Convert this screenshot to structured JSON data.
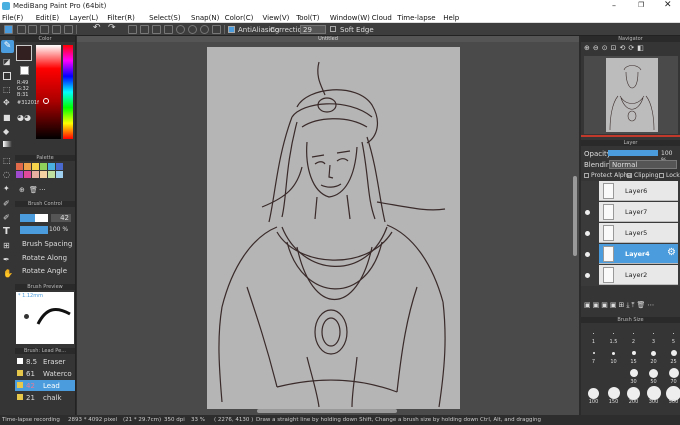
{
  "window": {
    "title": "MediBang Paint Pro (64bit)"
  },
  "menu": [
    "File(F)",
    "Edit(E)",
    "Layer(L)",
    "Filter(R)",
    "Select(S)",
    "Snap(N)",
    "Color(C)",
    "View(V)",
    "Tool(T)",
    "Window(W)",
    "Cloud",
    "Time-lapse",
    "Help"
  ],
  "toolbar": {
    "antialias_label": "AntiAliasing",
    "correction_label": "Correction",
    "correction_value": "29",
    "soft_edge_label": "Soft Edge"
  },
  "canvas": {
    "tab_title": "Untitled"
  },
  "color_panel": {
    "title": "Color",
    "r": "R:49",
    "g": "G:32",
    "b": "B:31",
    "hex": "#31201f",
    "main_color": "#31201f"
  },
  "palette": {
    "title": "Palette",
    "swatches": [
      "#e06a4a",
      "#f0a24a",
      "#f5d34a",
      "#8fd05a",
      "#4ab0e0",
      "#4a6ad0",
      "#a04ad0",
      "#e04a9a",
      "#e8b0a0",
      "#f5d0a0",
      "#c0e0a0",
      "#a0d0f0"
    ]
  },
  "brush_control": {
    "title": "Brush Control",
    "size_value": "42",
    "opacity_value": "100 %",
    "spacing_label": "Brush Spacing",
    "rotate_along_label": "Rotate Along",
    "rotate_angle_label": "Rotate Angle",
    "size_fill": 0.55,
    "opacity_fill": 1.0
  },
  "brush_preview": {
    "title": "Brush Preview",
    "size": "* 1.12mm"
  },
  "brush_list": {
    "title": "Brush: Lead Pe...",
    "items": [
      {
        "size": "8.5",
        "name": "Eraser",
        "color": "#ffffff"
      },
      {
        "size": "61",
        "name": "Waterco",
        "color": "#e8c84a"
      },
      {
        "size": "42",
        "name": "Lead",
        "color": "#e8c84a"
      },
      {
        "size": "21",
        "name": "chalk",
        "color": "#e8c84a"
      }
    ]
  },
  "navigator": {
    "title": "Navigator"
  },
  "layer_panel": {
    "title": "Layer",
    "opacity_label": "Opacity",
    "opacity_value": "100 %",
    "opacity_fill": 1.0,
    "blending_label": "Blending",
    "blending_value": "Normal",
    "protect_alpha": "Protect Alpha",
    "clipping": "Clipping",
    "lock": "Lock",
    "layers": [
      {
        "name": "Layer6",
        "visible": false,
        "selected": false
      },
      {
        "name": "Layer7",
        "visible": true,
        "selected": false
      },
      {
        "name": "Layer5",
        "visible": true,
        "selected": false
      },
      {
        "name": "Layer4",
        "visible": true,
        "selected": true
      },
      {
        "name": "Layer2",
        "visible": true,
        "selected": false
      }
    ]
  },
  "brush_size_panel": {
    "title": "Brush Size",
    "sizes": [
      "1",
      "1.5",
      "2",
      "3",
      "5",
      "7",
      "10",
      "15",
      "20",
      "25",
      "30",
      "50",
      "70",
      "100",
      "150",
      "200",
      "300",
      "500"
    ]
  },
  "status": {
    "recording": "Time-lapse recording",
    "dimensions": "2893 * 4092 pixel",
    "physical": "(21 * 29.7cm)",
    "dpi": "350 dpi",
    "zoom": "33 %",
    "coords": "( 2276, 4130 )",
    "hint": "Draw a straight line by holding down Shift, Change a brush size by holding down Ctrl, Alt, and dragging"
  }
}
